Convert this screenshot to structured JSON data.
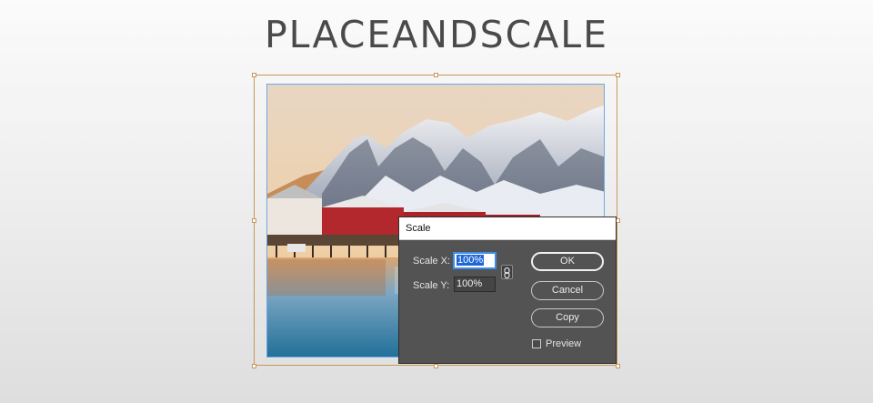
{
  "page": {
    "title": "PLACEANDSCALE"
  },
  "image": {
    "description_icon": "landscape-photo-icon"
  },
  "dialog": {
    "title": "Scale",
    "scale_x_label": "Scale X:",
    "scale_x_value": "100%",
    "scale_y_label": "Scale Y:",
    "scale_y_value": "100%",
    "constrain_icon": "chain-link-icon",
    "ok_label": "OK",
    "cancel_label": "Cancel",
    "copy_label": "Copy",
    "preview_label": "Preview",
    "preview_checked": false
  },
  "colors": {
    "selection_frame": "#c8965a",
    "image_border": "#6fa7e6",
    "dialog_bg": "#535353",
    "highlight": "#1e67d6"
  }
}
